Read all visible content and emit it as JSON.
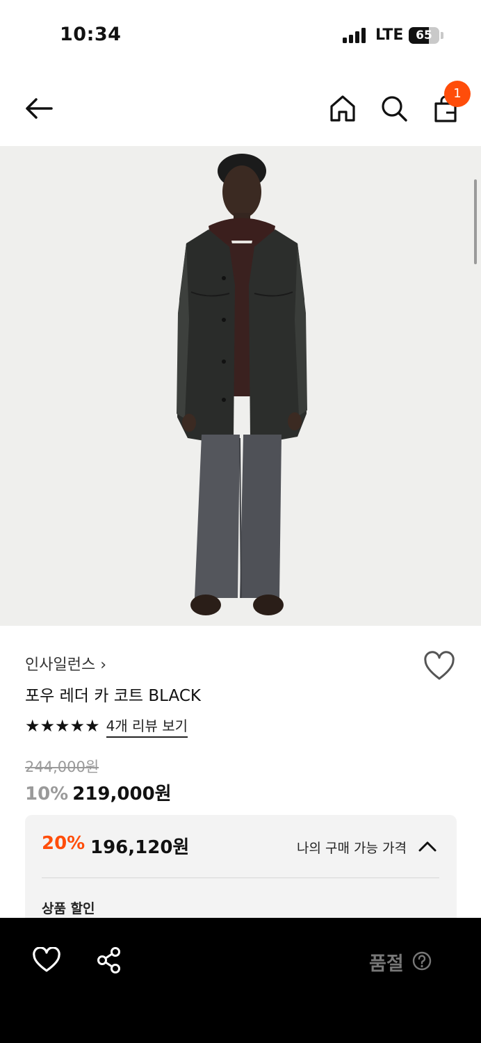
{
  "status_bar": {
    "time": "10:34",
    "network": "LTE",
    "battery": "65",
    "battery_level": 0.65
  },
  "header": {
    "cart_count": "1"
  },
  "icons": {
    "back": "arrow-left-icon",
    "home": "home-icon",
    "search": "search-icon",
    "bag": "shopping-bag-icon",
    "wish": "heart-icon",
    "share": "share-icon",
    "help": "question-icon",
    "collapse": "chevron-up-icon"
  },
  "product": {
    "brand": "인사일런스 ›",
    "name": "포우 레더 카 코트 BLACK",
    "rating_stars": 5,
    "stars": "★★★★★",
    "review_link": "4개 리뷰 보기",
    "original_price": "244,000원",
    "discount_rate": "10%",
    "sale_price": "219,000원"
  },
  "benefit": {
    "rate": "20%",
    "price": "196,120원",
    "label": "나의 구매 가능 가격",
    "section_title": "상품 할인"
  },
  "bottom_bar": {
    "status": "품절"
  },
  "colors": {
    "accent": "#ff4d0a",
    "bottom_bar": "#000000",
    "image_bg": "#efefed"
  }
}
